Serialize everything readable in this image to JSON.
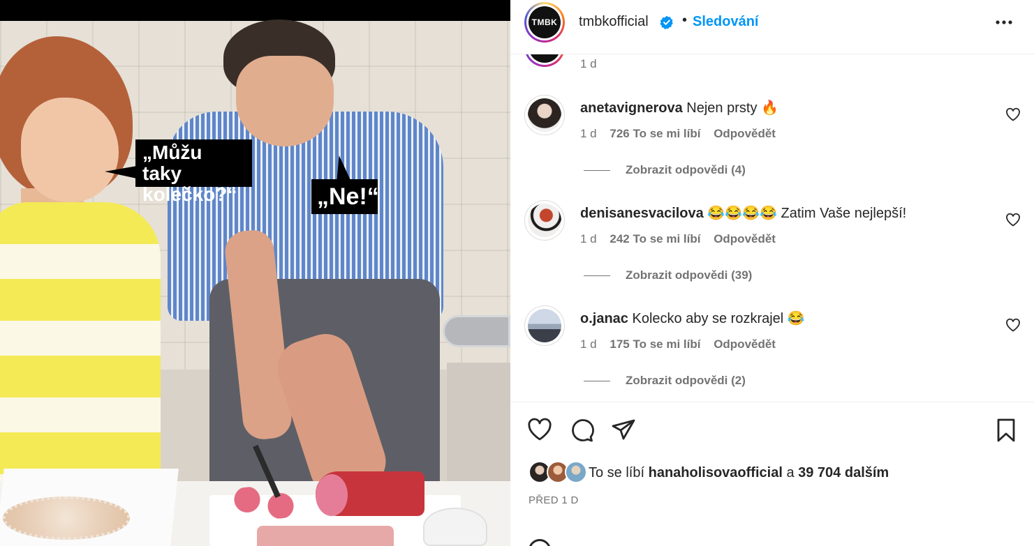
{
  "post": {
    "bubble_left": "„Můžu taky kolečko?“",
    "bubble_right": "„Ne!“"
  },
  "header": {
    "avatar_text": "TMBK",
    "username": "tmbkofficial",
    "separator": "•",
    "follow_label": "Sledování"
  },
  "previous": {
    "time": "1 d"
  },
  "comments": [
    {
      "user": "anetavignerova",
      "text": "Nejen prsty 🔥",
      "time": "1 d",
      "likes": "726 To se mi líbí",
      "reply": "Odpovědět",
      "replies": "Zobrazit odpovědi (4)"
    },
    {
      "user": "denisanesvacilova",
      "text": "😂😂😂😂 Zatim Vaše nejlepší!",
      "time": "1 d",
      "likes": "242 To se mi líbí",
      "reply": "Odpovědět",
      "replies": "Zobrazit odpovědi (39)"
    },
    {
      "user": "o.janac",
      "text": "Kolecko aby se rozkrajel 😂",
      "time": "1 d",
      "likes": "175 To se mi líbí",
      "reply": "Odpovědět",
      "replies": "Zobrazit odpovědi (2)"
    }
  ],
  "actions": {
    "liked_prefix": "To se líbí",
    "liked_user": "hanaholisovaofficial",
    "liked_conj": "a",
    "liked_count": "39 704 dalším",
    "post_time": "PŘED 1 D"
  },
  "icons": {
    "verified": "verified-badge-icon",
    "more": "more-options-icon",
    "comment_like": "heart-icon",
    "like": "heart-icon",
    "comment": "comment-icon",
    "share": "share-icon",
    "save": "bookmark-icon"
  },
  "colors": {
    "accent": "#0095f6",
    "text": "#262626",
    "muted": "#737373",
    "divider": "#efefef"
  }
}
